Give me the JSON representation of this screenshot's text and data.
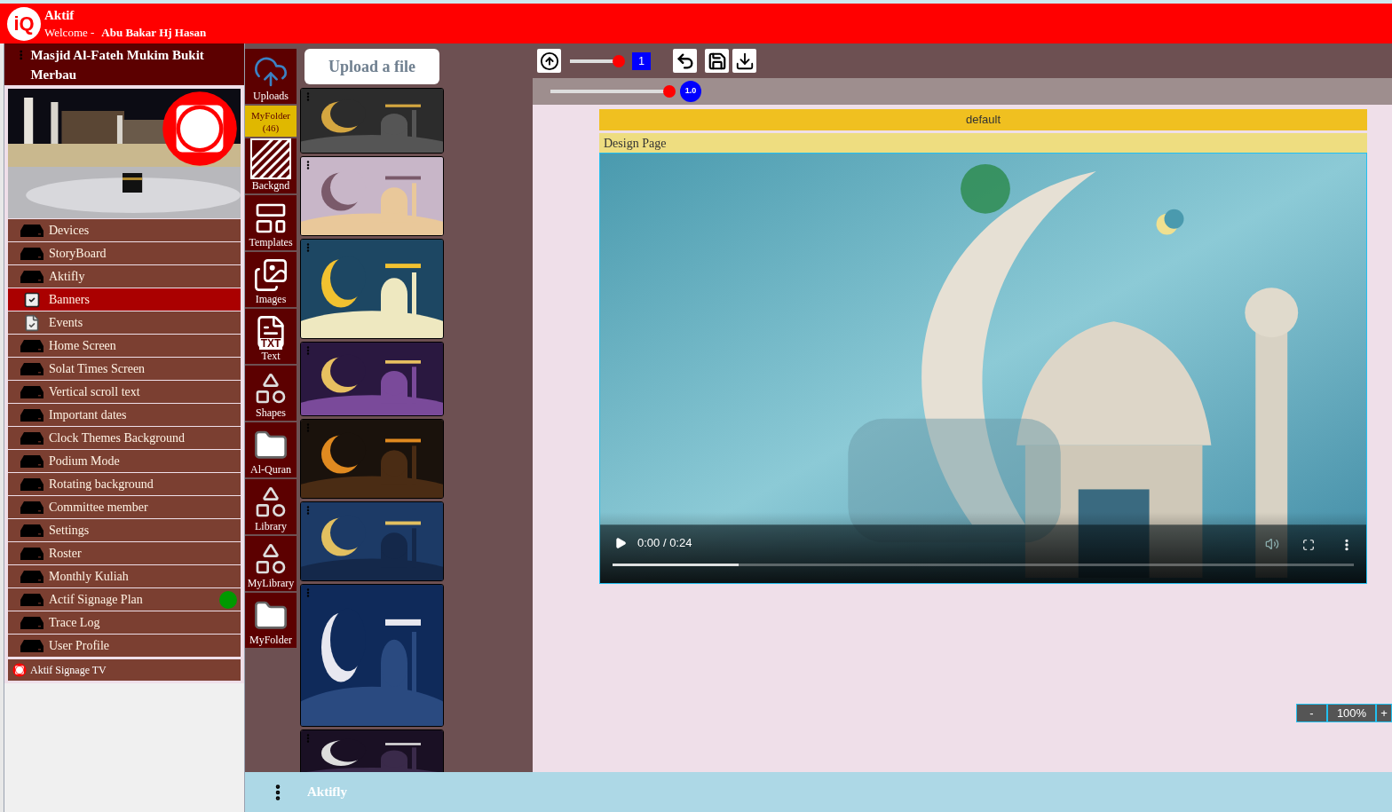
{
  "header": {
    "logo": "iQ",
    "title": "Aktif",
    "welcome": "Welcome -",
    "user": "Abu Bakar Hj Hasan"
  },
  "sidebar": {
    "title": "Masjid Al-Fateh Mukim Bukit Merbau",
    "items": [
      {
        "label": "Devices",
        "kind": "device",
        "selected": false
      },
      {
        "label": "StoryBoard",
        "kind": "device",
        "selected": false
      },
      {
        "label": "Aktifly",
        "kind": "device",
        "selected": false
      },
      {
        "label": "Banners",
        "kind": "checklist",
        "selected": true
      },
      {
        "label": "Events",
        "kind": "document",
        "selected": false
      },
      {
        "label": "Home Screen",
        "kind": "device",
        "selected": false
      },
      {
        "label": "Solat Times Screen",
        "kind": "device",
        "selected": false
      },
      {
        "label": "Vertical scroll text",
        "kind": "device",
        "selected": false
      },
      {
        "label": "Important dates",
        "kind": "device",
        "selected": false
      },
      {
        "label": "Clock Themes Background",
        "kind": "device",
        "selected": false
      },
      {
        "label": "Podium Mode",
        "kind": "device",
        "selected": false
      },
      {
        "label": "Rotating background",
        "kind": "device",
        "selected": false
      },
      {
        "label": "Committee member",
        "kind": "device",
        "selected": false
      },
      {
        "label": "Settings",
        "kind": "device",
        "selected": false
      },
      {
        "label": "Roster",
        "kind": "device",
        "selected": false
      },
      {
        "label": "Monthly Kuliah",
        "kind": "device",
        "selected": false
      },
      {
        "label": "Actif Signage Plan",
        "kind": "device",
        "selected": false,
        "color": "#009900"
      },
      {
        "label": "Trace Log",
        "kind": "device",
        "selected": false
      },
      {
        "label": "User Profile",
        "kind": "device",
        "selected": false
      }
    ],
    "footer": "Aktif Signage TV"
  },
  "tools": [
    {
      "label": "Uploads",
      "kind": "upload",
      "selected": false
    },
    {
      "label": "MyFolder (46)",
      "kind": "counter",
      "selected": true
    },
    {
      "label": "Backgnd",
      "kind": "background",
      "selected": false
    },
    {
      "label": "Templates",
      "kind": "templates",
      "selected": false
    },
    {
      "label": "Images",
      "kind": "images",
      "selected": false
    },
    {
      "label": "Text",
      "kind": "text",
      "selected": false,
      "badge": "TXT"
    },
    {
      "label": "Shapes",
      "kind": "shapes",
      "selected": false
    },
    {
      "label": "Al-Quran",
      "kind": "folder",
      "selected": false
    },
    {
      "label": "Library",
      "kind": "shapes",
      "selected": false
    },
    {
      "label": "MyLibrary",
      "kind": "shapes",
      "selected": false
    },
    {
      "label": "MyFolder",
      "kind": "folder",
      "selected": false
    }
  ],
  "upload_button": "Upload a file",
  "toolbar": {
    "size_slider": {
      "level": 0.92,
      "value": "1"
    },
    "scale_slider": {
      "level": 0.96,
      "value": "1.0"
    }
  },
  "canvas": {
    "layer": "default",
    "page_title": "Design Page",
    "video": {
      "time": "0:00 / 0:24",
      "level": 0.17
    }
  },
  "zoom": {
    "minus": "-",
    "value": "100%",
    "plus": "+"
  },
  "bottom_bar": {
    "title": "Aktifly"
  }
}
